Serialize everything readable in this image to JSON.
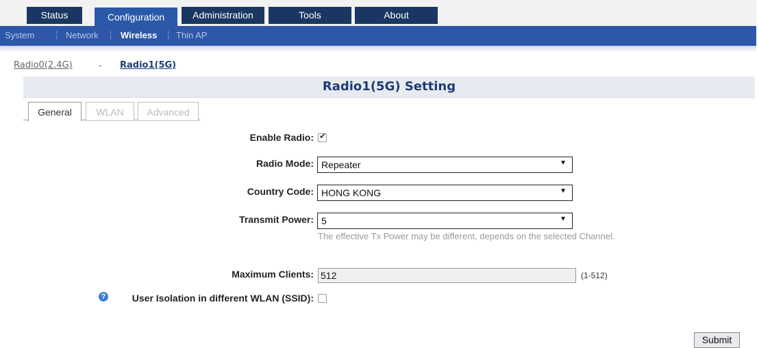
{
  "nav": {
    "tabs": [
      "Status",
      "Configuration",
      "Administration",
      "Tools",
      "About"
    ],
    "active_tab": "Configuration",
    "subtabs": [
      "System",
      "Network",
      "Wireless",
      "Thin AP"
    ],
    "active_subtab": "Wireless"
  },
  "radio_links": {
    "radio0": "Radio0(2.4G)",
    "separator": "-",
    "radio1": "Radio1(5G)"
  },
  "section": {
    "title": "Radio1(5G) Setting"
  },
  "page_tabs": [
    "General",
    "WLAN",
    "Advanced"
  ],
  "form": {
    "enable_radio": {
      "label": "Enable Radio:",
      "checked": true
    },
    "radio_mode": {
      "label": "Radio Mode:",
      "value": "Repeater"
    },
    "country_code": {
      "label": "Country Code:",
      "value": "HONG KONG"
    },
    "transmit_power": {
      "label": "Transmit Power:",
      "value": "5",
      "hint": "The effective Tx Power may be different, depends on the selected Channel."
    },
    "max_clients": {
      "label": "Maximum Clients:",
      "value": "512",
      "range": "(1-512)"
    },
    "user_isolation": {
      "label": "User Isolation in different WLAN (SSID):",
      "checked": false
    }
  },
  "submit_label": "Submit",
  "icons": {
    "info": "info-icon",
    "dropdown": "chevron-down-icon",
    "checkmark": "check-icon"
  }
}
